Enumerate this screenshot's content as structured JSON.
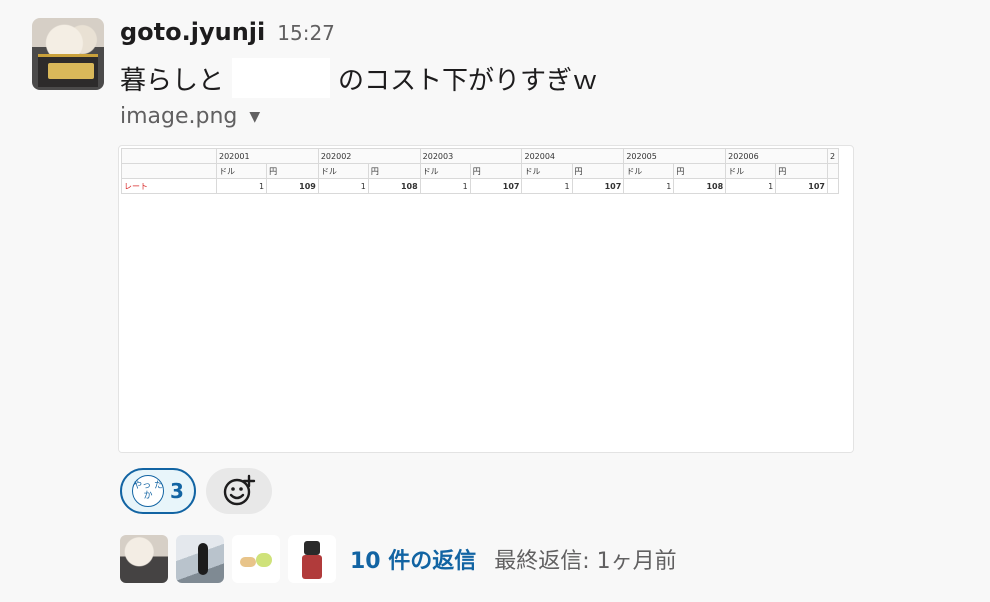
{
  "message": {
    "username": "goto.jyunji",
    "time": "15:27",
    "text_before": "暮らしと",
    "text_after": "のコスト下がりすぎｗ"
  },
  "attachment": {
    "file_name": "image.png",
    "sheet": {
      "periods": [
        "202001",
        "202002",
        "202003",
        "202004",
        "202005",
        "202006",
        "2"
      ],
      "unit_dollar": "ドル",
      "unit_yen": "円",
      "row_label": "レート",
      "rates": [
        {
          "dollar": "1",
          "yen": "109"
        },
        {
          "dollar": "1",
          "yen": "108"
        },
        {
          "dollar": "1",
          "yen": "107"
        },
        {
          "dollar": "1",
          "yen": "107"
        },
        {
          "dollar": "1",
          "yen": "108"
        },
        {
          "dollar": "1",
          "yen": "107"
        }
      ]
    }
  },
  "reactions": [
    {
      "emoji_text": "やっ たか",
      "count": "3"
    }
  ],
  "thread": {
    "reply_count": "10 件の返信",
    "last_reply": "最終返信: 1ヶ月前"
  },
  "icons": {
    "caret": "chevron-down-icon",
    "add_reaction": "add-reaction-icon"
  },
  "colors": {
    "link": "#1264a3",
    "muted": "#616061",
    "rate_label": "#d92b2b"
  }
}
